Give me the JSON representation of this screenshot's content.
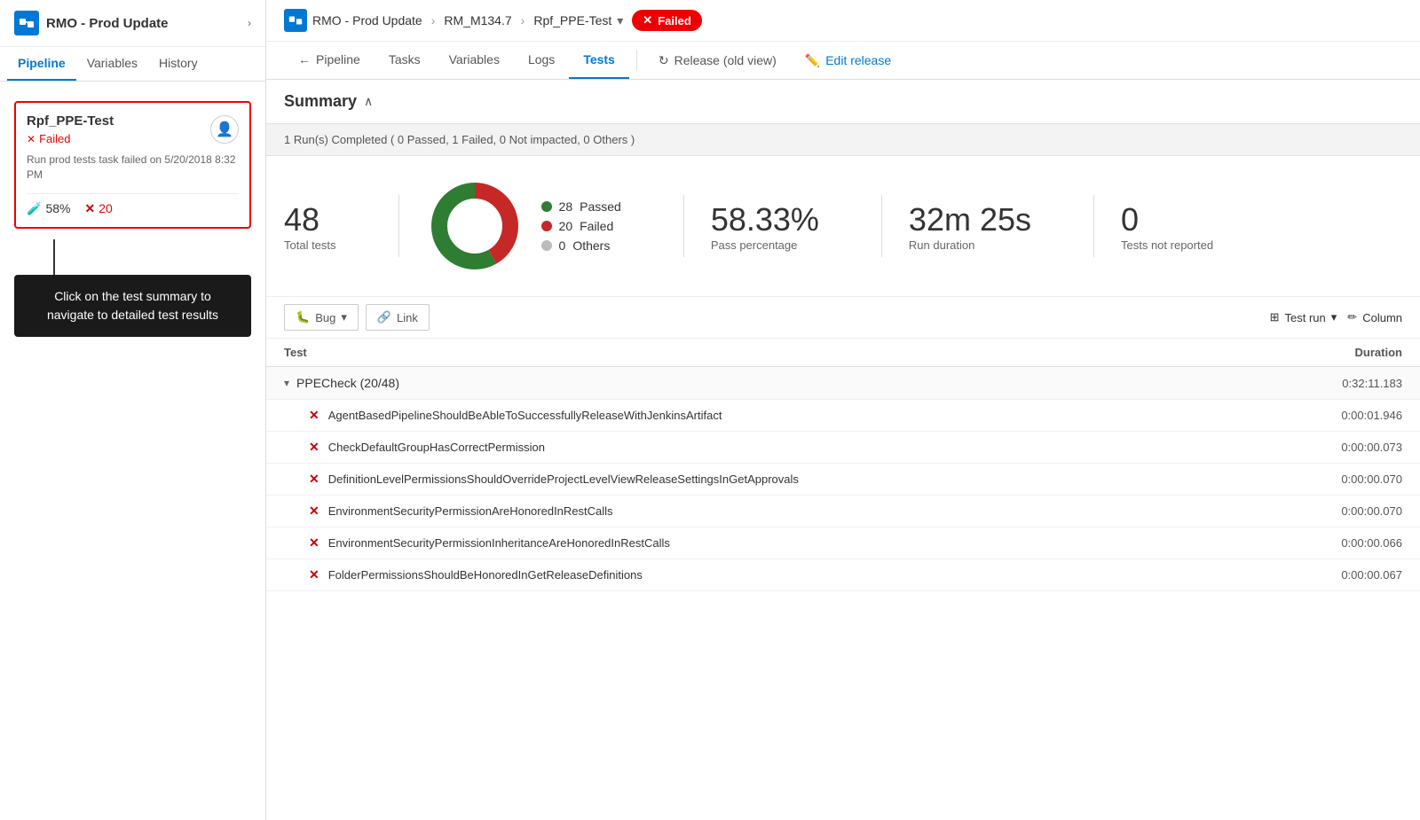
{
  "sidebar": {
    "logo_title": "RMO - Prod Update",
    "chevron": ">",
    "tabs": [
      "Pipeline",
      "Variables",
      "History"
    ],
    "active_tab": "Pipeline",
    "stage": {
      "name": "Rpf_PPE-Test",
      "status": "Failed",
      "avatar_icon": "👤",
      "info": "Run prod tests task failed on 5/20/2018 8:32 PM",
      "pass_pct": "58%",
      "fail_count": "20"
    },
    "tooltip": "Click on the test summary to navigate to detailed test results"
  },
  "header": {
    "breadcrumbs": [
      {
        "label": "RMO - Prod Update"
      },
      {
        "label": "RM_M134.7"
      },
      {
        "label": "Rpf_PPE-Test"
      }
    ],
    "failed_label": "Failed",
    "nav_items": [
      {
        "label": "Pipeline",
        "icon": "←",
        "active": false
      },
      {
        "label": "Tasks",
        "active": false
      },
      {
        "label": "Variables",
        "active": false
      },
      {
        "label": "Logs",
        "active": false
      },
      {
        "label": "Tests",
        "active": true
      }
    ],
    "release_old_view": "Release (old view)",
    "edit_release": "Edit release"
  },
  "summary": {
    "title": "Summary",
    "run_info": "1 Run(s) Completed ( 0 Passed, 1 Failed, 0 Not impacted, 0 Others )",
    "total_tests": "48",
    "total_label": "Total tests",
    "passed_count": "28",
    "failed_count": "20",
    "others_count": "0",
    "passed_label": "Passed",
    "failed_label": "Failed",
    "others_label": "Others",
    "pass_pct": "58.33%",
    "pass_pct_label": "Pass percentage",
    "run_duration": "32m 25s",
    "run_duration_label": "Run duration",
    "not_reported": "0",
    "not_reported_label": "Tests not reported",
    "chart": {
      "passed_deg": 208,
      "failed_deg": 152
    }
  },
  "action_bar": {
    "bug_label": "Bug",
    "link_label": "Link",
    "test_run_label": "Test run",
    "column_label": "Column"
  },
  "table": {
    "col_test": "Test",
    "col_duration": "Duration",
    "groups": [
      {
        "name": "PPECheck (20/48)",
        "duration": "0:32:11.183",
        "tests": [
          {
            "name": "AgentBasedPipelineShouldBeAbleToSuccessfullyReleaseWithJenkinsArtifact",
            "duration": "0:00:01.946",
            "status": "failed"
          },
          {
            "name": "CheckDefaultGroupHasCorrectPermission",
            "duration": "0:00:00.073",
            "status": "failed"
          },
          {
            "name": "DefinitionLevelPermissionsShouldOverrideProjectLevelViewReleaseSettingsInGetApprovals",
            "duration": "0:00:00.070",
            "status": "failed"
          },
          {
            "name": "EnvironmentSecurityPermissionAreHonoredInRestCalls",
            "duration": "0:00:00.070",
            "status": "failed"
          },
          {
            "name": "EnvironmentSecurityPermissionInheritanceAreHonoredInRestCalls",
            "duration": "0:00:00.066",
            "status": "failed"
          },
          {
            "name": "FolderPermissionsShouldBeHonoredInGetReleaseDefinitions",
            "duration": "0:00:00.067",
            "status": "failed"
          }
        ]
      }
    ]
  }
}
